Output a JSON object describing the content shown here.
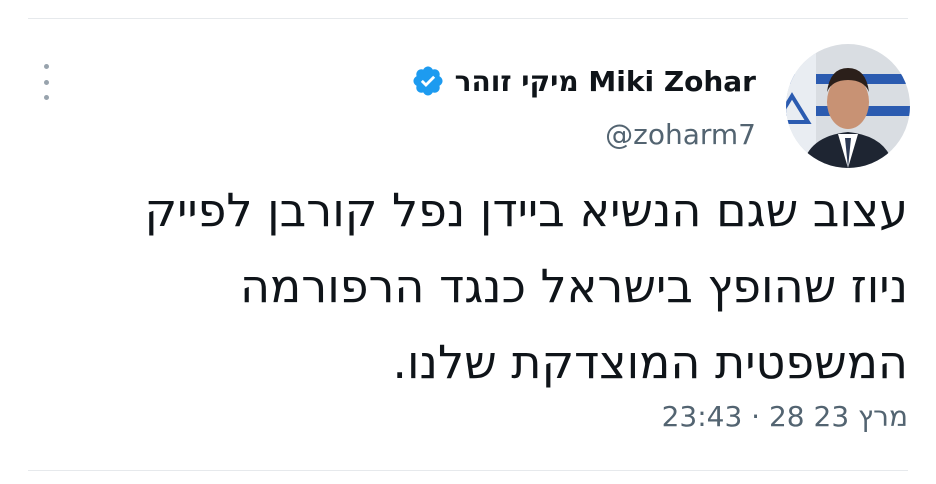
{
  "tweet": {
    "author": {
      "display_name": "מיקי זוהר Miki Zohar",
      "handle": "@zoharm7",
      "verified": true,
      "verified_icon": "verified-badge-icon",
      "verified_color": "#1d9bf0"
    },
    "text_lines": [
      "עצוב שגם הנשיא ביידן נפל קורבן לפייק",
      "ניוז שהופץ בישראל כנגד הרפורמה",
      "המשפטית המוצדקת שלנו."
    ],
    "timestamp": "23:43 · 28 מרץ 23"
  },
  "icons": {
    "more_menu": "more-vertical-icon"
  },
  "colors": {
    "text_primary": "#0f1419",
    "text_secondary": "#536471",
    "divider": "#e6e9ec",
    "accent": "#1d9bf0"
  }
}
